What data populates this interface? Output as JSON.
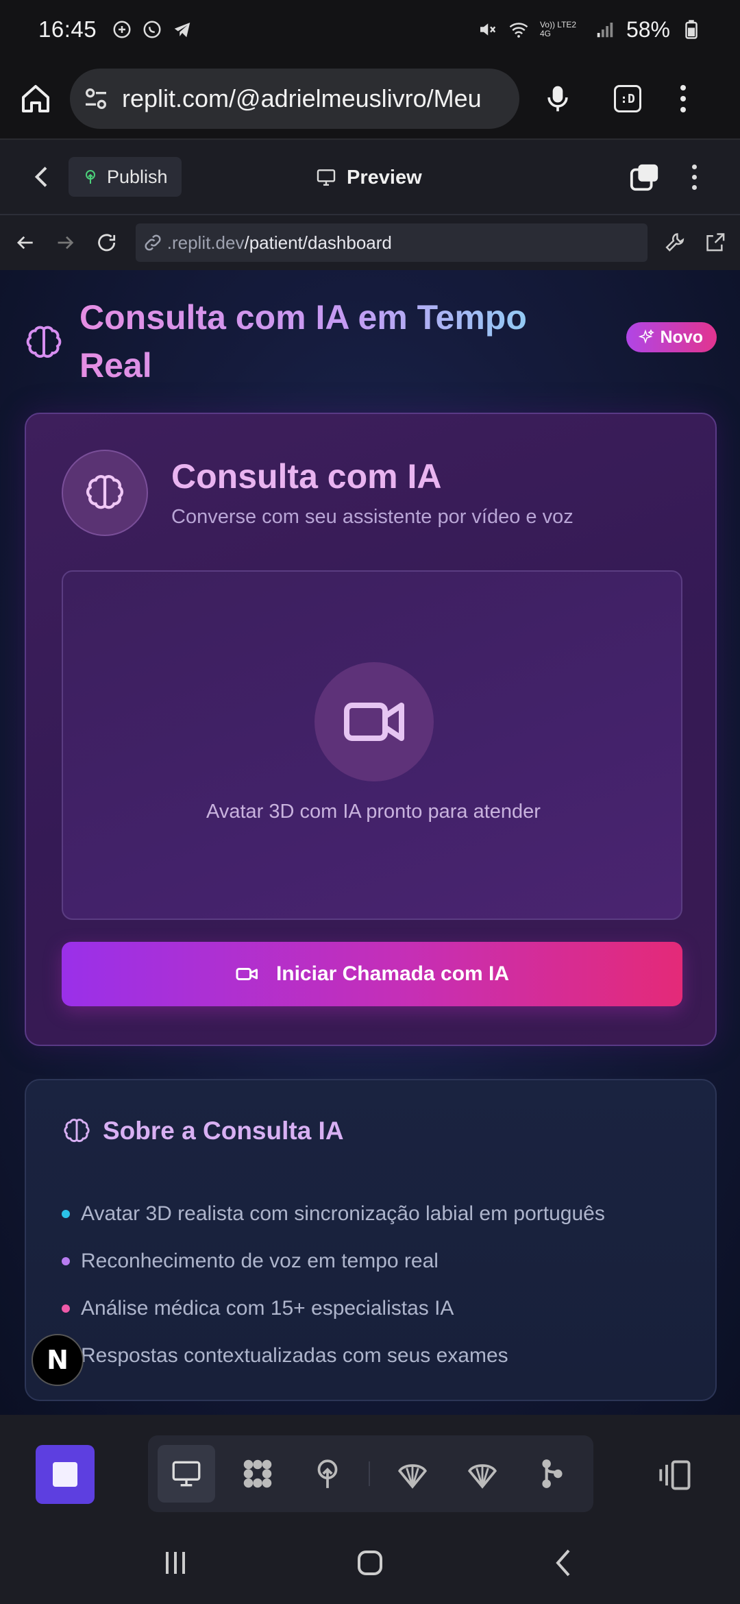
{
  "status_bar": {
    "time": "16:45",
    "network_label": "Vo)) LTE2 4G",
    "battery": "58%"
  },
  "browser": {
    "url": "replit.com/@adrielmeuslivro/Meu",
    "tabs_label": ":D"
  },
  "replit": {
    "publish_label": "Publish",
    "preview_label": "Preview"
  },
  "webview": {
    "host": ".replit.dev",
    "path": "/patient/dashboard"
  },
  "page": {
    "title": "Consulta com IA em Tempo Real",
    "badge": "Novo",
    "main_card": {
      "title": "Consulta com IA",
      "subtitle": "Converse com seu assistente por vídeo e voz",
      "video_caption": "Avatar 3D com IA pronto para atender",
      "call_button": "Iniciar Chamada com IA"
    },
    "about_card": {
      "title": "Sobre a Consulta IA",
      "items": [
        {
          "text": "Avatar 3D realista com sincronização labial em português",
          "color": "#2bc3e8"
        },
        {
          "text": "Reconhecimento de voz em tempo real",
          "color": "#b87cf0"
        },
        {
          "text": "Análise médica com 15+ especialistas IA",
          "color": "#ee5aa8"
        },
        {
          "text": "Respostas contextualizadas com seus exames",
          "color": "#8a8fe8"
        }
      ]
    },
    "next_badge": "N"
  },
  "colors": {
    "accent_purple": "#9a30e9",
    "accent_pink": "#e42a78",
    "replit_stop": "#5d3fe0"
  }
}
